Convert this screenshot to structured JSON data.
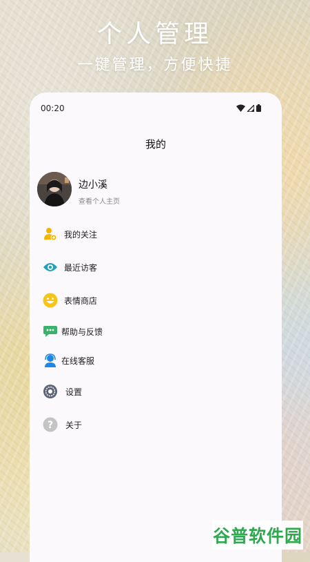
{
  "hero": {
    "title": "个人管理",
    "subtitle": "一键管理，方便快捷"
  },
  "status_bar": {
    "time": "00:20",
    "icons": [
      "wifi-icon",
      "signal-icon",
      "battery-icon"
    ]
  },
  "page": {
    "title": "我的"
  },
  "profile": {
    "name": "边小溪",
    "link": "查看个人主页"
  },
  "menu": [
    {
      "label": "我的关注",
      "icon": "person-follow-icon",
      "color": "#f5b400"
    },
    {
      "label": "最近访客",
      "icon": "eye-icon",
      "color": "#1fa2b8"
    },
    {
      "label": "表情商店",
      "icon": "smiley-icon",
      "color": "#f5c518"
    },
    {
      "label": "帮助与反馈",
      "icon": "chat-icon",
      "color": "#3bb26b"
    },
    {
      "label": "在线客服",
      "icon": "customer-service-icon",
      "color": "#1e88e5"
    },
    {
      "label": "设置",
      "icon": "gear-icon",
      "color": "#5a6478"
    },
    {
      "label": "关于",
      "icon": "question-icon",
      "color": "#c4c4c4"
    }
  ],
  "watermark": {
    "text": "谷普软件园"
  }
}
